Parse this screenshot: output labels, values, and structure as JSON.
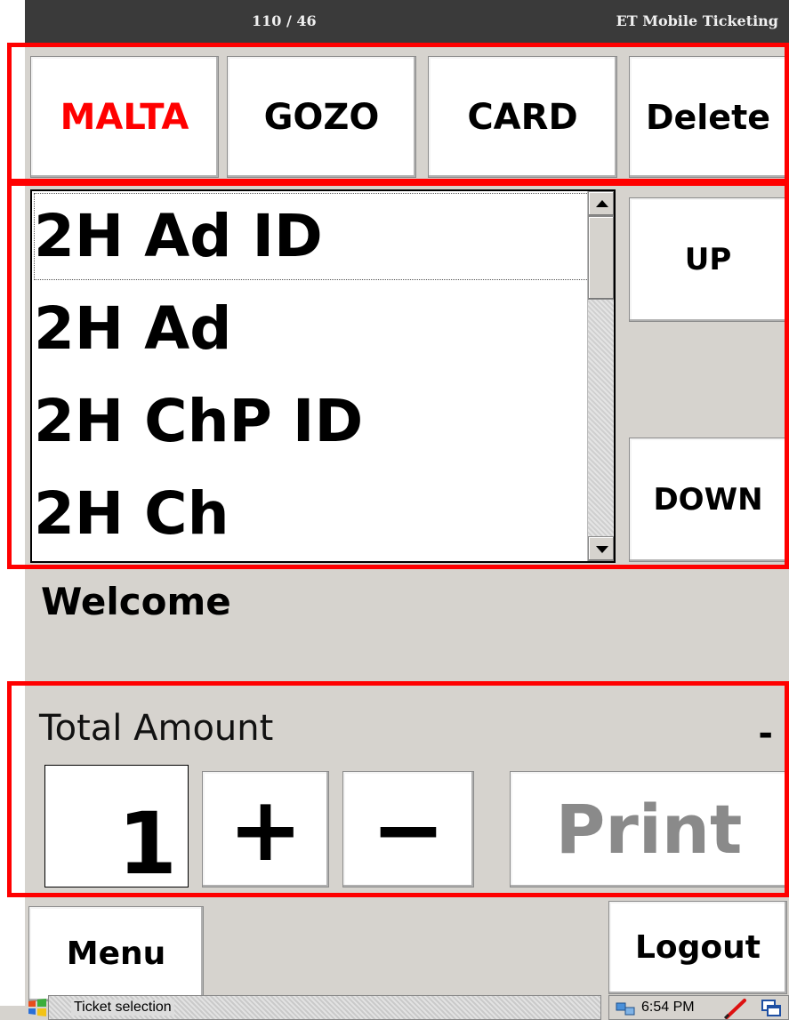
{
  "titlebar": {
    "counter": "110 / 46",
    "app_name": "ET Mobile Ticketing"
  },
  "zones": [
    {
      "label": "MALTA",
      "color": "#ff0000"
    },
    {
      "label": "GOZO",
      "color": "#000000"
    },
    {
      "label": "CARD",
      "color": "#000000"
    },
    {
      "label": "Delete",
      "color": "#000000"
    }
  ],
  "tickets": [
    "2H Ad ID",
    "2H Ad",
    "2H ChP ID",
    "2H Ch"
  ],
  "selected_ticket_index": 0,
  "nav": {
    "up": "UP",
    "down": "DOWN"
  },
  "message": "Welcome",
  "total": {
    "label": "Total Amount",
    "value": "-",
    "quantity": "1",
    "plus": "+",
    "minus": "−",
    "print": "Print"
  },
  "bottom": {
    "menu": "Menu",
    "logout": "Logout"
  },
  "taskbar": {
    "status": "Ticket selection",
    "time": "6:54 PM"
  },
  "colors": {
    "highlight": "#ff0000",
    "titlebar": "#3a3a3a",
    "background": "#d6d3ce",
    "print_disabled": "#8a8a8a"
  }
}
